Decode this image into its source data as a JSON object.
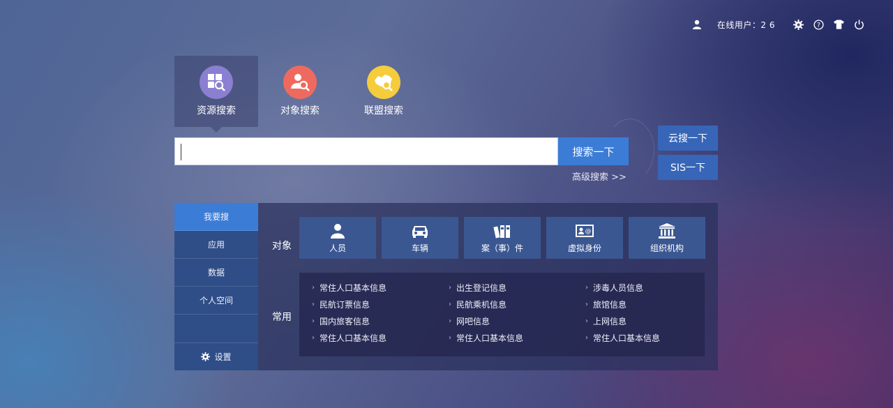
{
  "topbar": {
    "online_label": "在线用户：2 6",
    "icons": [
      "user-icon",
      "gear-icon",
      "help-icon",
      "shirt-icon",
      "power-icon"
    ]
  },
  "search_tabs": [
    {
      "label": "资源搜索",
      "icon": "resource-search-icon",
      "color": "#8a7fd0",
      "active": true
    },
    {
      "label": "对象搜索",
      "icon": "person-search-icon",
      "color": "#ee6a5f",
      "active": false
    },
    {
      "label": "联盟搜索",
      "icon": "map-search-icon",
      "color": "#f5cc3c",
      "active": false
    }
  ],
  "search": {
    "value": "",
    "placeholder": "",
    "button_label": "搜索一下",
    "advanced_label": "高级搜索 >>",
    "cloud_label": "云搜一下",
    "sis_label": "SIS一下"
  },
  "sidenav": {
    "items": [
      {
        "label": "我要搜",
        "active": true
      },
      {
        "label": "应用",
        "active": false
      },
      {
        "label": "数据",
        "active": false
      },
      {
        "label": "个人空间",
        "active": false
      }
    ],
    "settings_label": "设置"
  },
  "objects": {
    "row_label": "对象",
    "tiles": [
      {
        "label": "人员",
        "icon": "person-icon"
      },
      {
        "label": "车辆",
        "icon": "car-icon"
      },
      {
        "label": "案（事）件",
        "icon": "case-files-icon"
      },
      {
        "label": "虚拟身份",
        "icon": "id-card-icon"
      },
      {
        "label": "组织机构",
        "icon": "institution-icon"
      }
    ]
  },
  "common": {
    "row_label": "常用",
    "links": [
      "常住人口基本信息",
      "出生登记信息",
      "涉毒人员信息",
      "民航订票信息",
      "民航乘机信息",
      "旅馆信息",
      "国内旅客信息",
      "网吧信息",
      "上网信息",
      "常住人口基本信息",
      "常住人口基本信息",
      "常住人口基本信息"
    ]
  },
  "colors": {
    "accent": "#3b7cd6",
    "sidenav_bg": "#2f4e88",
    "tile_bg": "#3b5792",
    "side_button": "#3766b8"
  }
}
